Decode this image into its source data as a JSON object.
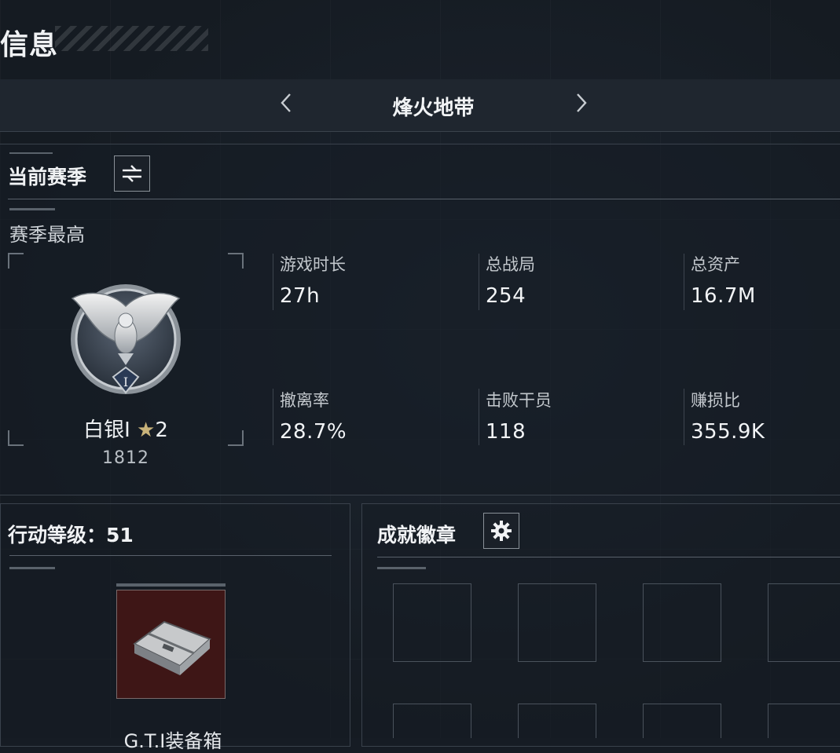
{
  "header": {
    "title": "信息"
  },
  "mode_selector": {
    "title": "烽火地带",
    "prev_icon": "chevron-left-icon",
    "next_icon": "chevron-right-icon"
  },
  "season": {
    "heading": "当前赛季",
    "swap_icon": "swap-icon",
    "best_label": "赛季最高",
    "rank_name": "白银I",
    "rank_star_icon": "star-icon",
    "rank_stars": "2",
    "rank_score": "1812",
    "stats": [
      {
        "label": "游戏时长",
        "value": "27h"
      },
      {
        "label": "总战局",
        "value": "254"
      },
      {
        "label": "总资产",
        "value": "16.7M"
      },
      {
        "label": "撤离率",
        "value": "28.7%"
      },
      {
        "label": "击败干员",
        "value": "118"
      },
      {
        "label": "赚损比",
        "value": "355.9K"
      }
    ]
  },
  "action_level": {
    "heading": "行动等级：51",
    "item_name": "G.T.I装备箱"
  },
  "achievements": {
    "heading": "成就徽章",
    "settings_icon": "gear-icon",
    "slot_count": 8
  },
  "colors": {
    "background": "#161c24",
    "item_card": "#3e1616",
    "text": "#e6e9ec"
  }
}
